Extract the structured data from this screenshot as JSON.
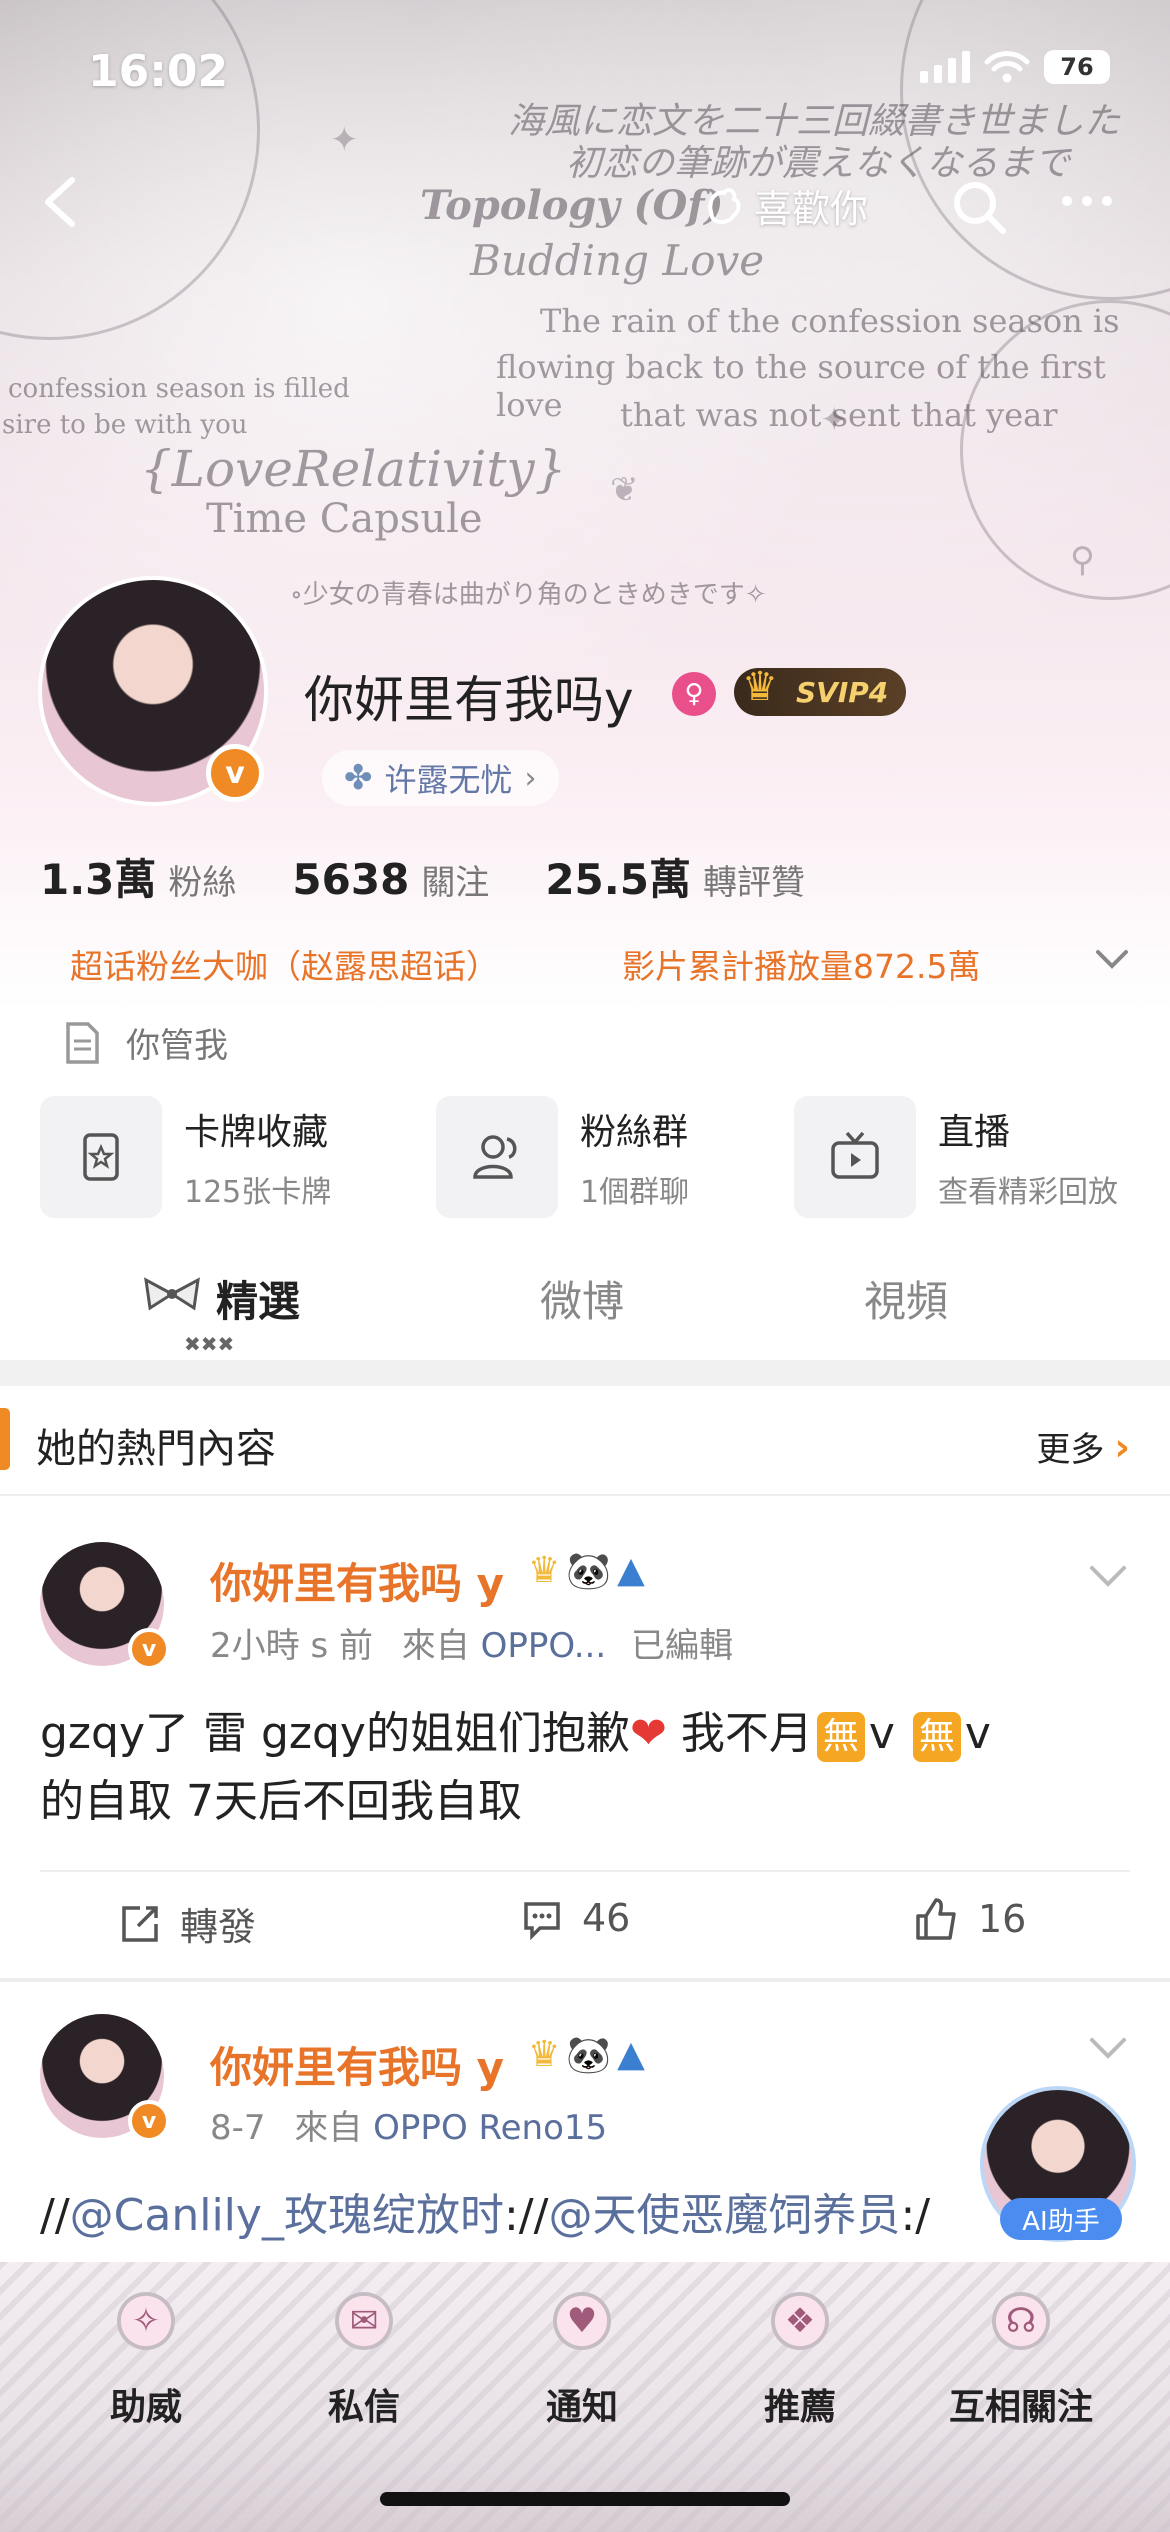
{
  "status_bar": {
    "time": "16:02",
    "battery": "76"
  },
  "nav": {
    "like_label": "喜歡你"
  },
  "banner": {
    "line1": "海風に恋文を二十三回綴書き世ました",
    "line2": "初恋の筆跡が震えなくなるまで",
    "topology": "Topology (Of)",
    "budding": "Budding Love",
    "rain1": "The rain of the confession season is",
    "rain2": "flowing back to the source of the first love",
    "rain3": "that was not sent that year",
    "conf1": "confession season is filled",
    "conf2": "sire to be with you",
    "love_rel": "{LoveRelativity}",
    "capsule": "Time Capsule",
    "girl_line": "∘少女の青春は曲がり角のときめきです✧"
  },
  "profile": {
    "name": "你妍里有我吗y",
    "svip": "SVIP4",
    "fan_group": "许露无忧",
    "stats": [
      {
        "num": "1.3萬",
        "label": "粉絲"
      },
      {
        "num": "5638",
        "label": "關注"
      },
      {
        "num": "25.5萬",
        "label": "轉評贊"
      }
    ],
    "tag_left": "超话粉丝大咖（赵露思超话）",
    "tag_right": "影片累計播放量872.5萬",
    "bio": "你管我"
  },
  "tools": [
    {
      "title": "卡牌收藏",
      "sub": "125张卡牌"
    },
    {
      "title": "粉絲群",
      "sub": "1個群聊"
    },
    {
      "title": "直播",
      "sub": "查看精彩回放"
    }
  ],
  "tabs": [
    "精選",
    "微博",
    "視頻"
  ],
  "hot": {
    "title": "她的熱門內容",
    "more": "更多"
  },
  "post1": {
    "name": "你妍里有我吗 y",
    "time": "2小時 s 前",
    "from": "來自",
    "source": "OPPO...",
    "edited": "已編輯",
    "text_a": "gzqy了 雷 gzqy的姐姐们抱歉",
    "text_b": " 我不月",
    "emoji1": "無",
    "text_c": "v ",
    "emoji2": "無",
    "text_d": "v",
    "text_line2": "的自取 7天后不回我自取",
    "repost": "轉發",
    "comments": "46",
    "likes": "16"
  },
  "post2": {
    "name": "你妍里有我吗 y",
    "time": "8-7",
    "from": "來自",
    "source": "OPPO Reno15",
    "text_prefix": "//",
    "mention1": "@Canlily_玫瑰绽放时",
    "sep": "://",
    "mention2": "@天使恶魔饲养员",
    "text_suffix": ":/"
  },
  "ai": {
    "label": "AI助手"
  },
  "bottom": [
    "助威",
    "私信",
    "通知",
    "推薦",
    "互相關注"
  ],
  "colors": {
    "accent": "#f08a24",
    "name_orange": "#e8742a",
    "link_blue": "#5a6f9c"
  }
}
